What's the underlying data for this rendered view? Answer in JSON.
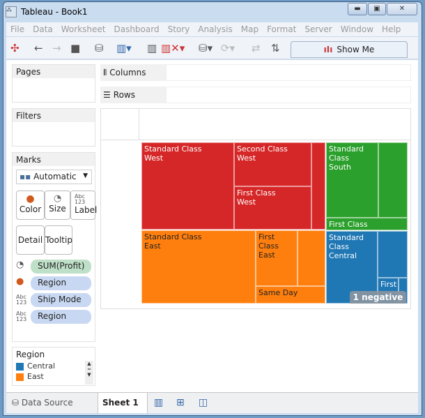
{
  "window": {
    "title": "Tableau - Book1"
  },
  "menu": [
    "File",
    "Data",
    "Worksheet",
    "Dashboard",
    "Story",
    "Analysis",
    "Map",
    "Format",
    "Server",
    "Window",
    "Help"
  ],
  "toolbar": {
    "show_me": "Show Me"
  },
  "panels": {
    "pages": "Pages",
    "filters": "Filters",
    "marks": "Marks",
    "mark_type": "Automatic"
  },
  "shelves": {
    "columns": "Columns",
    "rows": "Rows"
  },
  "mark_buttons": {
    "color": "Color",
    "size": "Size",
    "label": "Label",
    "detail": "Detail",
    "tooltip": "Tooltip",
    "abc": "Abc",
    "num": "123"
  },
  "pills": [
    {
      "label": "SUM(Profit)",
      "type": "size"
    },
    {
      "label": "Region",
      "type": "color"
    },
    {
      "label": "Ship Mode",
      "type": "label"
    },
    {
      "label": "Region",
      "type": "label"
    }
  ],
  "legend": {
    "title": "Region",
    "items": [
      {
        "label": "Central",
        "color": "#1f77b4"
      },
      {
        "label": "East",
        "color": "#ff7f0e"
      }
    ]
  },
  "treemap": {
    "colors": {
      "West": "#d62728",
      "South": "#2ca02c",
      "East": "#ff7f0e",
      "Central": "#1f77b4"
    },
    "labels": {
      "std_west": [
        "Standard Class",
        "West"
      ],
      "second_west": [
        "Second Class",
        "West"
      ],
      "first_west": [
        "First Class",
        "West"
      ],
      "std_south": [
        "Standard",
        "Class",
        "South"
      ],
      "first_south": "First Class",
      "std_east": [
        "Standard Class",
        "East"
      ],
      "first_east": [
        "First Class",
        "East"
      ],
      "sameday_east": "Same Day",
      "std_central": [
        "Standard",
        "Class",
        "Central"
      ],
      "first_central": "First"
    },
    "badge": "1 negative"
  },
  "bottom": {
    "data_source": "Data Source",
    "sheet": "Sheet 1"
  }
}
